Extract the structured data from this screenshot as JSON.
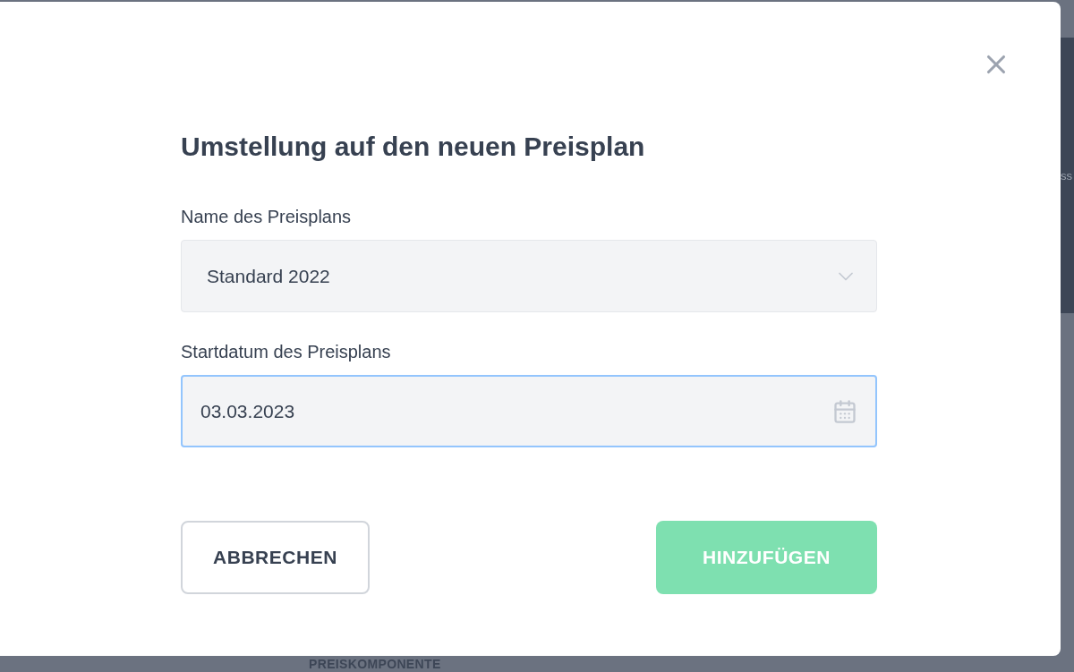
{
  "dialog": {
    "title": "Umstellung auf den neuen Preisplan",
    "fields": [
      {
        "kind": "select",
        "label": "Name des Preisplans",
        "value": "Standard 2022",
        "focused": false
      },
      {
        "kind": "date",
        "label": "Startdatum des Preisplans",
        "value": "03.03.2023",
        "focused": true
      }
    ],
    "buttons": [
      {
        "kind": "secondary",
        "label": "ABBRECHEN",
        "disabled": false
      },
      {
        "kind": "primary",
        "label": "HINZUFÜGEN",
        "disabled": true
      }
    ]
  },
  "background": {
    "side_text": "ss",
    "bottom_heading": "PREISKOMPONENTE"
  }
}
